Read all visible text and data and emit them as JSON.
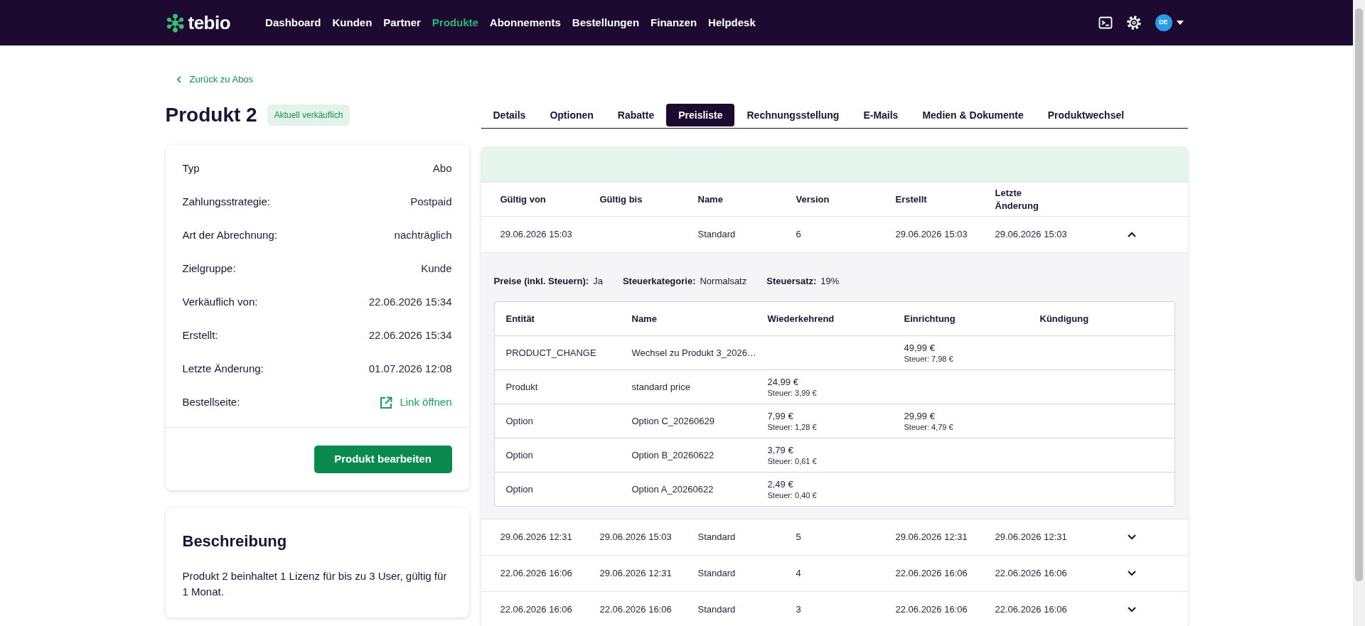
{
  "navbar": {
    "logo": "tebio",
    "links": [
      {
        "label": "Dashboard",
        "selected": false
      },
      {
        "label": "Kunden",
        "selected": false
      },
      {
        "label": "Partner",
        "selected": false
      },
      {
        "label": "Produkte",
        "selected": true
      },
      {
        "label": "Abonnements",
        "selected": false
      },
      {
        "label": "Bestellungen",
        "selected": false
      },
      {
        "label": "Finanzen",
        "selected": false
      },
      {
        "label": "Helpdesk",
        "selected": false
      }
    ],
    "avatar": "DE"
  },
  "back_link": "Zurück zu Abos",
  "product": {
    "title": "Produkt 2",
    "status_badge": "Aktuell verkäuflich"
  },
  "details": [
    {
      "kind": "text",
      "label": "Typ",
      "value": "Abo"
    },
    {
      "kind": "text",
      "label": "Zahlungsstrategie:",
      "value": "Postpaid"
    },
    {
      "kind": "text",
      "label": "Art der Abrechnung:",
      "value": "nachträglich"
    },
    {
      "kind": "text",
      "label": "Zielgruppe:",
      "value": "Kunde"
    },
    {
      "kind": "text",
      "label": "Verkäuflich von:",
      "value": "22.06.2026 15:34"
    },
    {
      "kind": "text",
      "label": "Erstellt:",
      "value": "22.06.2026 15:34"
    },
    {
      "kind": "text",
      "label": "Letzte Änderung:",
      "value": "01.07.2026 12:08"
    },
    {
      "kind": "link",
      "label": "Bestellseite:",
      "value": "Link öffnen"
    }
  ],
  "edit_button": "Produkt bearbeiten",
  "description": {
    "title": "Beschreibung",
    "text": "Produkt 2 beinhaltet 1 Lizenz für bis zu 3 User, gültig für 1 Monat."
  },
  "tabs": [
    {
      "label": "Details",
      "selected": false
    },
    {
      "label": "Optionen",
      "selected": false
    },
    {
      "label": "Rabatte",
      "selected": false
    },
    {
      "label": "Preisliste",
      "selected": true
    },
    {
      "label": "Rechnungsstellung",
      "selected": false
    },
    {
      "label": "E-Mails",
      "selected": false
    },
    {
      "label": "Medien & Dokumente",
      "selected": false
    },
    {
      "label": "Produktwechsel",
      "selected": false
    }
  ],
  "price_lists": {
    "columns": [
      "Gültig von",
      "Gültig bis",
      "Name",
      "Version",
      "Erstellt",
      "Letzte Änderung"
    ],
    "rows": [
      {
        "valid_from": "29.06.2026 15:03",
        "name": "Standard",
        "version": "6",
        "created": "29.06.2026 15:03",
        "modified": "29.06.2026 15:03",
        "expanded": true,
        "detail": {
          "tax_info": [
            {
              "label": "Preise (inkl. Steuern):",
              "value": "Ja"
            },
            {
              "label": "Steuerkategorie:",
              "value": "Normalsatz"
            },
            {
              "label": "Steuersatz:",
              "value": "19%"
            }
          ],
          "columns": [
            "Entität",
            "Name",
            "Wiederkehrend",
            "Einrichtung",
            "Kündigung"
          ],
          "prices": [
            {
              "entity": "PRODUCT_CHANGE",
              "name": "Wechsel zu Produkt 3_2026…",
              "setup": {
                "amount": "49,99 €",
                "tax": "Steuer: 7,98 €"
              }
            },
            {
              "entity": "Produkt",
              "name": "standard price",
              "recurring": {
                "amount": "24,99 €",
                "tax": "Steuer: 3,99 €"
              }
            },
            {
              "entity": "Option",
              "name": "Option C_20260629",
              "recurring": {
                "amount": "7,99 €",
                "tax": "Steuer: 1,28 €"
              },
              "setup": {
                "amount": "29,99 €",
                "tax": "Steuer: 4,79 €"
              }
            },
            {
              "entity": "Option",
              "name": "Option B_20260622",
              "recurring": {
                "amount": "3,79 €",
                "tax": "Steuer: 0,61 €"
              }
            },
            {
              "entity": "Option",
              "name": "Option A_20260622",
              "recurring": {
                "amount": "2,49 €",
                "tax": "Steuer: 0,40 €"
              }
            }
          ]
        }
      },
      {
        "valid_from": "29.06.2026 12:31",
        "valid_to": "29.06.2026 15:03",
        "name": "Standard",
        "version": "5",
        "created": "29.06.2026 12:31",
        "modified": "29.06.2026 12:31",
        "expanded": false
      },
      {
        "valid_from": "22.06.2026 16:06",
        "valid_to": "29.06.2026 12:31",
        "name": "Standard",
        "version": "4",
        "created": "22.06.2026 16:06",
        "modified": "22.06.2026 16:06",
        "expanded": false
      },
      {
        "valid_from": "22.06.2026 16:06",
        "valid_to": "22.06.2026 16:06",
        "name": "Standard",
        "version": "3",
        "created": "22.06.2026 16:06",
        "modified": "22.06.2026 16:06",
        "expanded": false
      }
    ]
  }
}
